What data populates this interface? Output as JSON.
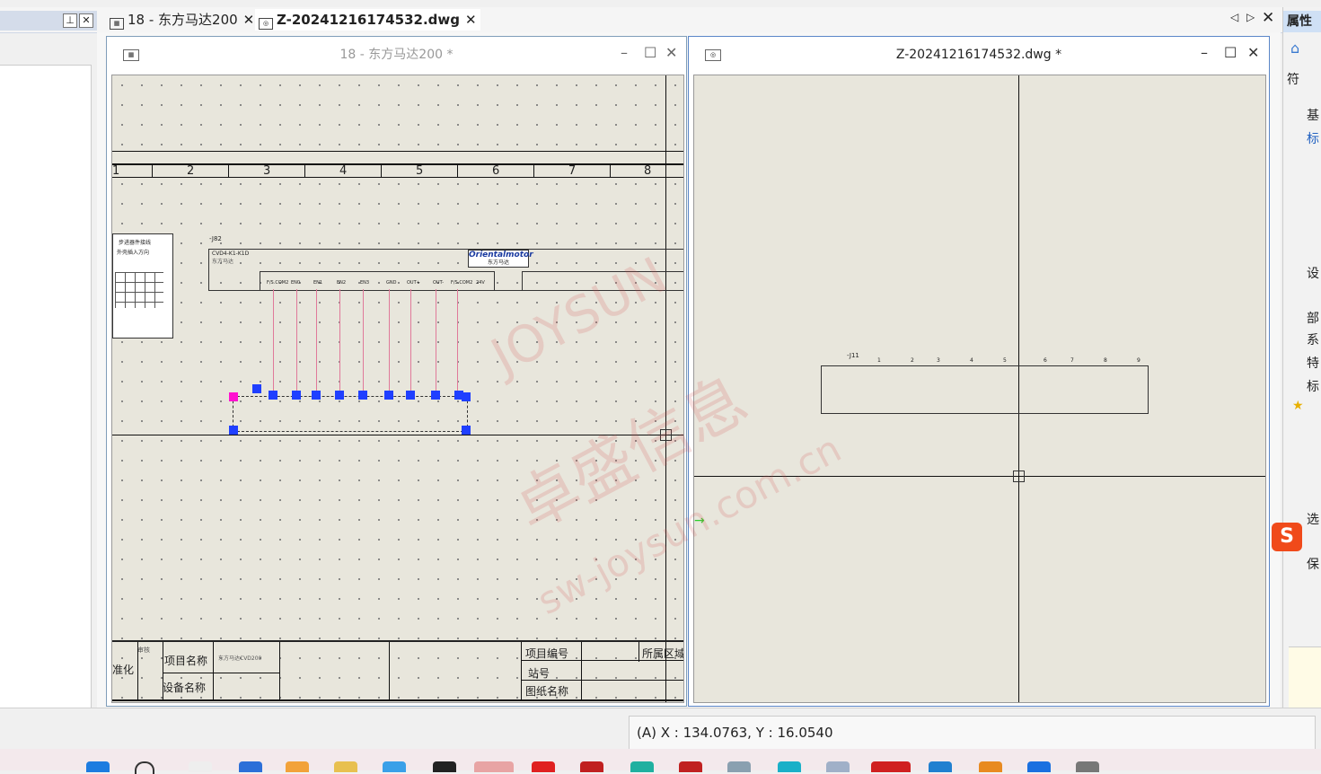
{
  "tabs": {
    "pin_glyph": "⊥",
    "close_glyph": "✕",
    "tab1_label": "18 - 东方马达200",
    "tab2_label": "Z-20241216174532.dwg",
    "nav_prev": "◁",
    "nav_next": "▷"
  },
  "right_panel": {
    "title": "属性",
    "items": [
      "符",
      "基",
      "标",
      "设",
      "部",
      "系",
      "特",
      "标",
      "选",
      "保"
    ]
  },
  "window_left": {
    "title": "18 - 东方马达200 *",
    "columns": [
      "1",
      "2",
      "3",
      "4",
      "5",
      "6",
      "7",
      "8"
    ],
    "device_tag": "-J82",
    "device_model": "CVD4-K1-K1D",
    "device_maker": "东方马达",
    "brand": "Orientalmotor",
    "brand_sub": "东方马达",
    "terminal_labels": [
      "F/S.COM2",
      "EN0",
      "EN1",
      "EN2",
      "EN3",
      "GND",
      "OUT+",
      "OUT-",
      "F/S.COM2",
      "24V"
    ],
    "left_box_title": "步进器件接线",
    "left_box_sub": "外壳插入方向",
    "titleblock": {
      "project_name": "项目名称",
      "equipment_name": "设备名称",
      "standardize": "准化",
      "review": "审核",
      "project_value": "东方马达CVD200",
      "project_no": "项目编号",
      "station": "站号",
      "drawing_name": "图纸名称",
      "area": "所属区域"
    }
  },
  "window_right": {
    "title": "Z-20241216174532.dwg *",
    "device_tag": "-J11",
    "terminals": [
      "1",
      "2",
      "3",
      "4",
      "5",
      "6",
      "7",
      "8",
      "9"
    ]
  },
  "watermark": {
    "line1": "JOYSUN",
    "line2": "卓盛信息",
    "line3": "sw-joysun.com.cn"
  },
  "status": {
    "coords": "(A) X : 134.0763, Y : 16.0540"
  }
}
